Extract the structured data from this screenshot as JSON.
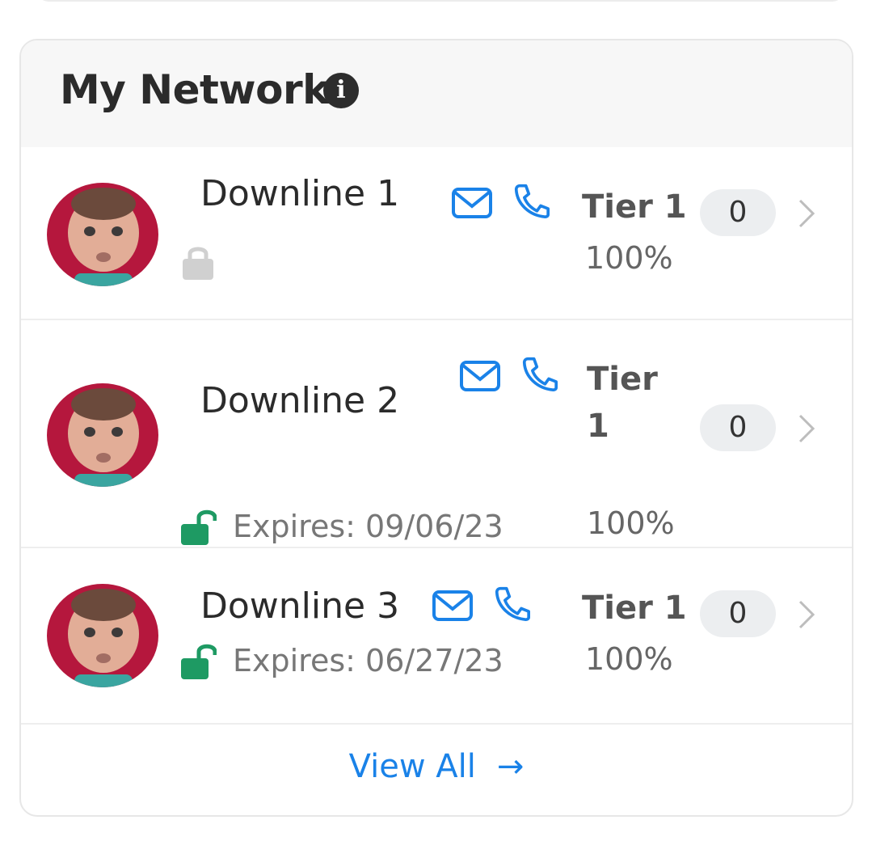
{
  "network": {
    "title": "My Network",
    "info_icon": "info-icon",
    "rows": [
      {
        "name": "Downline 1",
        "tier": "Tier 1",
        "percent": "100%",
        "count": "0",
        "lock_state": "locked",
        "expires": ""
      },
      {
        "name": "Downline 2",
        "tier": "Tier 1",
        "percent": "100%",
        "count": "0",
        "lock_state": "unlocked",
        "expires": "Expires: 09/06/23"
      },
      {
        "name": "Downline 3",
        "tier": "Tier 1",
        "percent": "100%",
        "count": "0",
        "lock_state": "unlocked",
        "expires": "Expires: 06/27/23"
      }
    ],
    "view_all_label": "View All",
    "view_all_arrow": "→"
  },
  "colors": {
    "accent_blue": "#1a82e8",
    "unlocked_green": "#1e9a63",
    "locked_gray": "#d0d0d0",
    "avatar_ring": "#c2163f"
  }
}
